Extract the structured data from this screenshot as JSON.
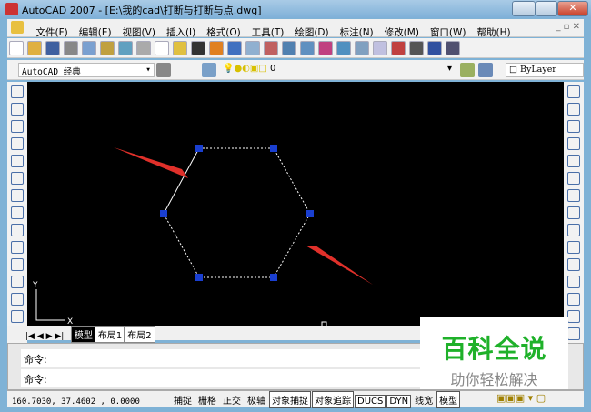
{
  "window": {
    "title": "AutoCAD 2007 - [E:\\我的cad\\打断与打断与点.dwg]"
  },
  "menu": [
    "文件(F)",
    "编辑(E)",
    "视图(V)",
    "插入(I)",
    "格式(O)",
    "工具(T)",
    "绘图(D)",
    "标注(N)",
    "修改(M)",
    "窗口(W)",
    "帮助(H)"
  ],
  "toolbar2": {
    "workspace": "AutoCAD 经典",
    "layer": "0",
    "color": "ByLayer"
  },
  "ucs": {
    "x": "X",
    "y": "Y"
  },
  "tabs": [
    "模型",
    "布局1",
    "布局2"
  ],
  "command": {
    "line1": "命令:",
    "line2": "命令:"
  },
  "status": {
    "coords": "160.7030,  37.4602 , 0.0000",
    "buttons": [
      {
        "label": "捕捉",
        "on": false
      },
      {
        "label": "栅格",
        "on": false
      },
      {
        "label": "正交",
        "on": false
      },
      {
        "label": "极轴",
        "on": false
      },
      {
        "label": "对象捕捉",
        "on": true
      },
      {
        "label": "对象追踪",
        "on": true
      },
      {
        "label": "DUCS",
        "on": true
      },
      {
        "label": "DYN",
        "on": true
      },
      {
        "label": "线宽",
        "on": false
      },
      {
        "label": "模型",
        "on": true
      }
    ]
  },
  "watermark": {
    "title": "百科全说",
    "subtitle": "助你轻松解决"
  },
  "colors": {
    "grip": "#1a3fd0",
    "arrow": "#e0302a",
    "canvas": "#000000"
  }
}
